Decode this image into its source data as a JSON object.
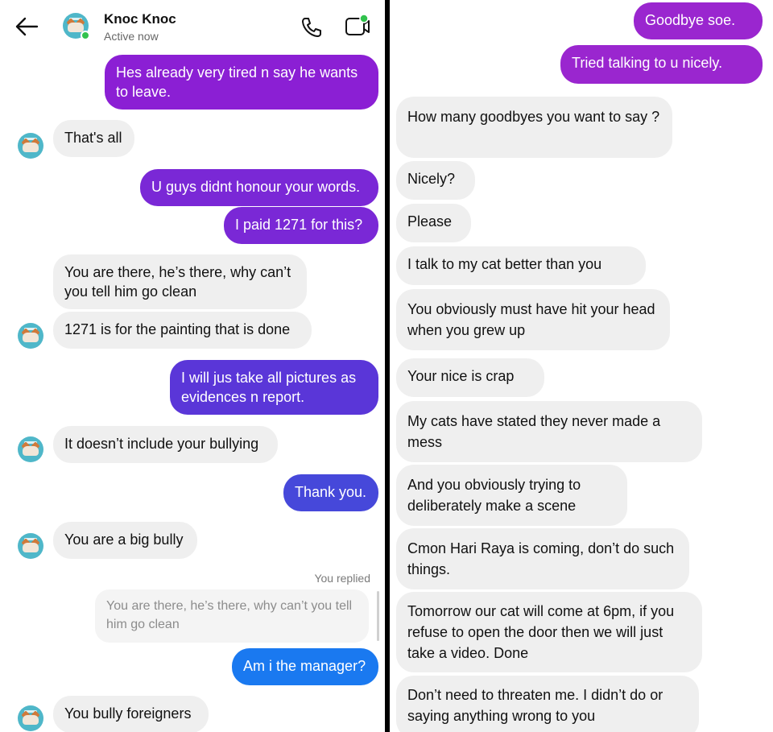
{
  "header": {
    "contact_name": "Knoc Knoc",
    "status": "Active now",
    "icons": [
      "back-arrow-icon",
      "phone-icon",
      "video-call-icon"
    ]
  },
  "left_thread": [
    {
      "dir": "out",
      "text": "Hes already very tired n say he wants to leave.",
      "color": "#8b1fd4"
    },
    {
      "dir": "in",
      "text": "That's all"
    },
    {
      "dir": "out",
      "text": "U guys didnt honour your words.",
      "color": "#7a28d6"
    },
    {
      "dir": "out",
      "text": "I paid 1271 for this?",
      "color": "#7a28d6"
    },
    {
      "dir": "in",
      "text": "You are there, he’s there, why can’t you tell him go clean"
    },
    {
      "dir": "in",
      "text": "1271 is for the painting that is done"
    },
    {
      "dir": "out",
      "text": "I will jus take all pictures as evidences n report.",
      "color": "#5a36d8"
    },
    {
      "dir": "in",
      "text": "It doesn’t include your bullying"
    },
    {
      "dir": "out",
      "text": "Thank you.",
      "color": "#4648da"
    },
    {
      "dir": "in",
      "text": "You are a big bully"
    },
    {
      "dir": "reply_label",
      "text": "You replied"
    },
    {
      "dir": "quoted",
      "text": "You are there, he’s there, why can’t you tell him go clean"
    },
    {
      "dir": "out",
      "text": "Am i the manager?",
      "color": "#1a79f0"
    },
    {
      "dir": "in",
      "text": "You bully foreigners"
    }
  ],
  "right_thread": [
    {
      "dir": "out",
      "text": "Goodbye soe.",
      "color": "#9a26cf"
    },
    {
      "dir": "out",
      "text": "Tried talking to u nicely.",
      "color": "#9a26cf"
    },
    {
      "dir": "in",
      "text": "How many goodbyes you want to say ?"
    },
    {
      "dir": "in",
      "text": "Nicely?"
    },
    {
      "dir": "in",
      "text": "Please"
    },
    {
      "dir": "in",
      "text": "I talk to my cat better than you"
    },
    {
      "dir": "in",
      "text": "You obviously must have hit your head when you grew up"
    },
    {
      "dir": "in",
      "text": "Your nice is crap"
    },
    {
      "dir": "in",
      "text": "My cats have stated they never made a mess"
    },
    {
      "dir": "in",
      "text": "And you obviously trying to deliberately make a scene"
    },
    {
      "dir": "in",
      "text": "Cmon Hari Raya is coming, don’t do such things."
    },
    {
      "dir": "in",
      "text": "Tomorrow our cat will come at 6pm, if you refuse to open the door then we will just take a video. Done"
    },
    {
      "dir": "in",
      "text": "Don’t need to threaten me. I didn’t do or saying anything wrong to you"
    }
  ],
  "colors": {
    "incoming_bubble": "#efefef",
    "online_status": "#31c24d",
    "avatar_bg": "#4fb7c9"
  }
}
